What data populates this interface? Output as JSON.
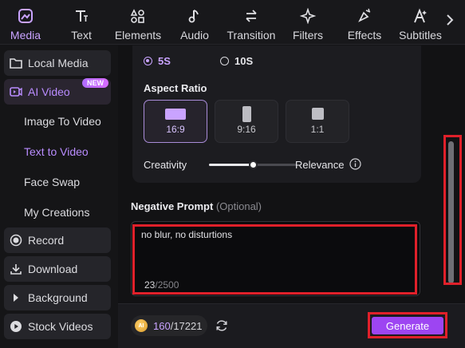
{
  "toolbar": {
    "items": [
      {
        "label": "Media",
        "icon": "media-icon",
        "active": true
      },
      {
        "label": "Text",
        "icon": "text-icon"
      },
      {
        "label": "Elements",
        "icon": "elements-icon"
      },
      {
        "label": "Audio",
        "icon": "audio-icon"
      },
      {
        "label": "Transition",
        "icon": "transition-icon"
      },
      {
        "label": "Filters",
        "icon": "filters-icon"
      },
      {
        "label": "Effects",
        "icon": "effects-icon"
      },
      {
        "label": "Subtitles",
        "icon": "subtitles-icon"
      }
    ],
    "more_icon": "chevron-right-icon"
  },
  "sidebar": {
    "local_media": "Local Media",
    "ai_video": "AI Video",
    "new_badge": "NEW",
    "image_to_video": "Image To Video",
    "text_to_video": "Text to Video",
    "face_swap": "Face Swap",
    "my_creations": "My Creations",
    "record": "Record",
    "download": "Download",
    "background": "Background",
    "stock_videos": "Stock Videos"
  },
  "duration": {
    "option_5s": "5S",
    "option_10s": "10S",
    "selected": "5S"
  },
  "aspect": {
    "title": "Aspect Ratio",
    "options": [
      "16:9",
      "9:16",
      "1:1"
    ],
    "selected": "16:9"
  },
  "slider": {
    "left_label": "Creativity",
    "right_label": "Relevance",
    "value": 0.5
  },
  "negative": {
    "title": "Negative Prompt",
    "optional": "(Optional)",
    "text": "no blur, no disturtions",
    "count": "23",
    "max": "/2500"
  },
  "footer": {
    "coin_label": "AI",
    "credits_current": "160",
    "credits_total": "/17221",
    "generate": "Generate"
  },
  "colors": {
    "accent": "#c9a3ff",
    "generate_bg": "#9d45f2",
    "highlight": "#e0202a"
  }
}
